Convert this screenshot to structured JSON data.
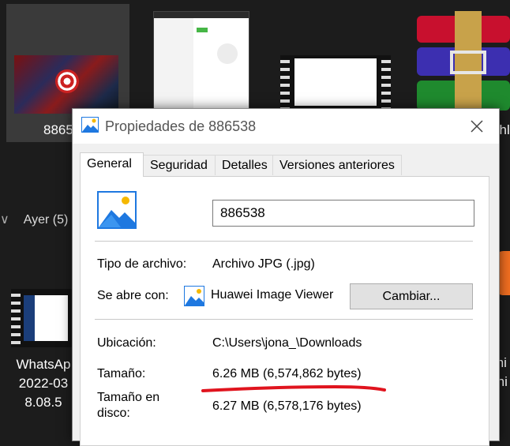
{
  "explorer": {
    "tile1_label": "8865",
    "group_header": "Ayer (5)",
    "whatsapp_label": [
      "WhatsAp",
      "2022-03",
      "8.08.5"
    ],
    "right_labels": [
      "chl",
      "mi",
      "rni"
    ]
  },
  "dialog": {
    "title": "Propiedades de 886538",
    "tabs": [
      "General",
      "Seguridad",
      "Detalles",
      "Versiones anteriores"
    ],
    "filename": "886538",
    "rows": {
      "type_label": "Tipo de archivo:",
      "type_value": "Archivo JPG (.jpg)",
      "opens_label": "Se abre con:",
      "opens_value": "Huawei Image Viewer",
      "change_button": "Cambiar...",
      "location_label": "Ubicación:",
      "location_value": "C:\\Users\\jona_\\Downloads",
      "size_label": "Tamaño:",
      "size_value": "6.26 MB (6,574,862 bytes)",
      "disk_label_line1": "Tamaño en",
      "disk_label_line2": "disco:",
      "disk_value": "6.27 MB (6,578,176 bytes)"
    }
  },
  "colors": {
    "accent_blue": "#1e90ff",
    "annotation_red": "#e0141e"
  },
  "icons": [
    "image-file-icon",
    "close-icon",
    "huawei-image-viewer-icon",
    "chevron-down-icon"
  ]
}
